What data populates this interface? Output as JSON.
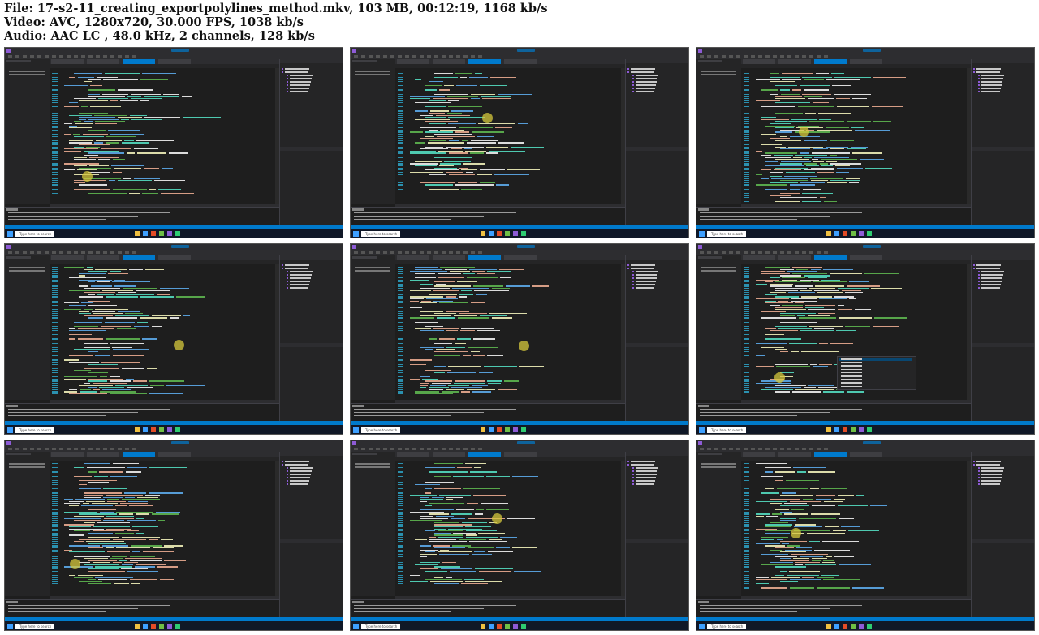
{
  "header": {
    "file_line": "File: 17-s2-11_creating_exportpolylines_method.mkv, 103 MB, 00:12:19, 1168 kb/s",
    "video_line": "Video: AVC, 1280x720, 30.000 FPS, 1038 kb/s",
    "audio_line": "Audio: AAC LC , 48.0 kHz, 2 channels, 128 kb/s"
  },
  "taskbar": {
    "search_placeholder": "Type here to search"
  },
  "colors": {
    "ide_background": "#1e1e1e",
    "ide_chrome": "#2d2d30",
    "accent_blue": "#007acc",
    "taskbar": "#101827",
    "cursor_highlight": "#d6c83c",
    "keyword": "#569cd6",
    "string": "#d69d85",
    "comment": "#57a64a",
    "type": "#4ec9b0",
    "identifier": "#dcdcdc",
    "method": "#dcdcaa"
  },
  "thumbnails": [
    {
      "id": 1,
      "scene": "excel-export-method",
      "has_popup": false
    },
    {
      "id": 2,
      "scene": "excel-export-method-scrolled",
      "has_popup": false
    },
    {
      "id": 3,
      "scene": "excel-export-loop",
      "has_popup": false
    },
    {
      "id": 4,
      "scene": "commands-class-get-objects",
      "has_popup": false
    },
    {
      "id": 5,
      "scene": "commands-class-new-function",
      "has_popup": false
    },
    {
      "id": 6,
      "scene": "commands-class-intellisense",
      "has_popup": true
    },
    {
      "id": 7,
      "scene": "commands-class-function-body",
      "has_popup": false
    },
    {
      "id": 8,
      "scene": "excel-export-method-top",
      "has_popup": false
    },
    {
      "id": 9,
      "scene": "excel-export-method-end",
      "has_popup": false
    }
  ]
}
